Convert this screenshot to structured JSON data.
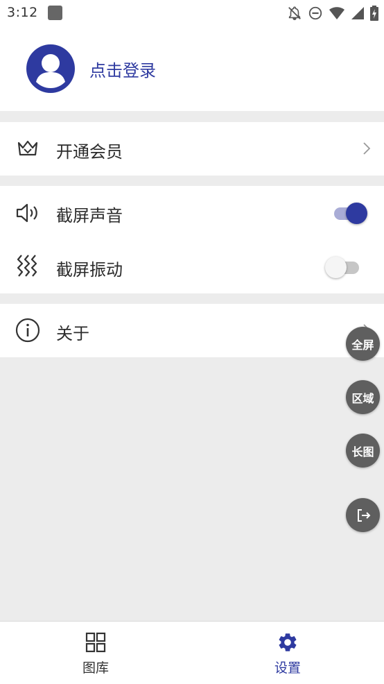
{
  "status_bar": {
    "time": "3:12",
    "icons": [
      "notification-square-icon",
      "bell-off-icon",
      "do-not-disturb-icon",
      "wifi-icon",
      "signal-icon",
      "battery-charging-icon"
    ]
  },
  "profile": {
    "login_label": "点击登录"
  },
  "menu": {
    "vip": {
      "label": "开通会员",
      "icon": "crown-icon"
    },
    "screenshot_sound": {
      "label": "截屏声音",
      "icon": "speaker-icon",
      "enabled": true
    },
    "screenshot_vibration": {
      "label": "截屏振动",
      "icon": "vibration-icon",
      "enabled": false
    },
    "about": {
      "label": "关于",
      "icon": "info-icon"
    }
  },
  "floating_actions": {
    "fullscreen": "全屏",
    "region": "区域",
    "long_image": "长图",
    "exit_icon": "exit-icon"
  },
  "bottom_nav": {
    "gallery": {
      "label": "图库",
      "icon": "grid-icon",
      "active": false
    },
    "settings": {
      "label": "设置",
      "icon": "gear-icon",
      "active": true
    }
  },
  "colors": {
    "accent": "#2e3aa0",
    "background": "#ececec",
    "floating_button": "#5f5f5f"
  }
}
